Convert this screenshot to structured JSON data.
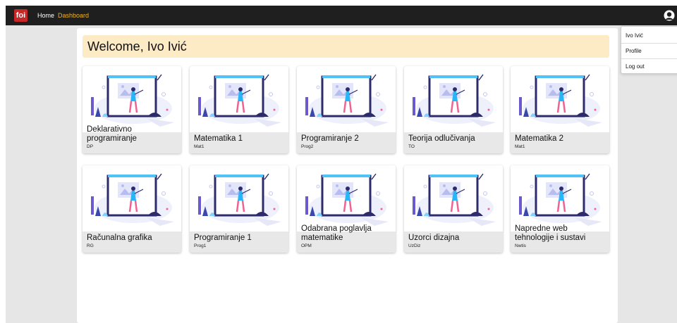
{
  "navbar": {
    "logo_text": "foi",
    "links": [
      {
        "label": "Home"
      },
      {
        "label": "Dashboard",
        "active": true
      }
    ],
    "avatar_icon": "user-avatar-icon"
  },
  "welcome": "Welcome, Ivo Ivić",
  "courses": [
    {
      "title": "Deklarativno programiranje",
      "code": "DP"
    },
    {
      "title": "Matematika 1",
      "code": "Mat1"
    },
    {
      "title": "Programiranje 2",
      "code": "Prog2"
    },
    {
      "title": "Teorija odlučivanja",
      "code": "TO"
    },
    {
      "title": "Matematika 2",
      "code": "Mat1"
    },
    {
      "title": "Računalna grafika",
      "code": "RG"
    },
    {
      "title": "Programiranje 1",
      "code": "Prog1"
    },
    {
      "title": "Odabrana poglavlja matematike",
      "code": "OPM"
    },
    {
      "title": "Uzorci dizajna",
      "code": "UzDiz"
    },
    {
      "title": "Napredne web tehnologije i sustavi",
      "code": "Nwtis"
    }
  ],
  "dropdown": {
    "user_name": "Ivo Ivić",
    "profile": "Profile",
    "logout": "Log out"
  },
  "colors": {
    "navbar": "#1f1f1f",
    "logo": "#c62828",
    "active_link": "#f0b429",
    "welcome_bg": "#fdebc6",
    "card_bg": "#e8e8e8",
    "page_bg": "#e6e6e6"
  }
}
